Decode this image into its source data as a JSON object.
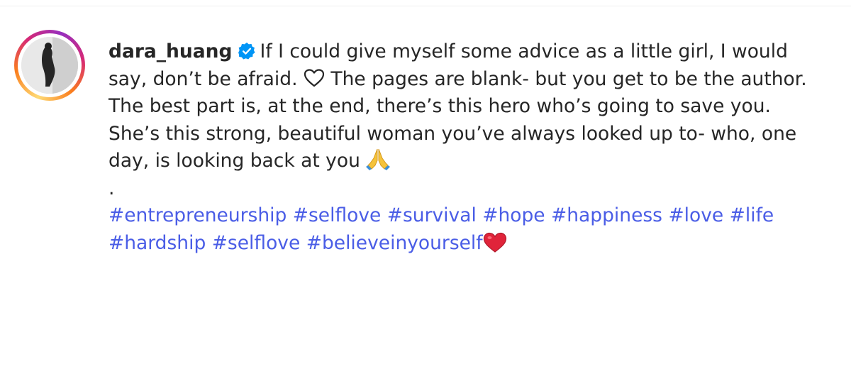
{
  "post": {
    "username": "dara_huang",
    "verified": true,
    "caption_text": "If I could give myself some advice as a little girl, I would say, don’t be afraid.",
    "caption_text_2": "The pages are blank- but you get to be the author. The best part is, at the end, there’s this hero who’s going to save you. She’s this strong, beautiful woman you’ve always looked up to- who, one day, is looking back at you",
    "separator": ".",
    "hashtags": [
      "#entrepreneurship",
      "#selflove",
      "#survival",
      "#hope",
      "#happiness",
      "#love",
      "#life",
      "#hardship",
      "#selflove",
      "#believeinyourself"
    ],
    "emojis": [
      "white-heart-icon",
      "folded-hands-icon",
      "red-heart-icon"
    ]
  },
  "colors": {
    "hashtag": "#4a5de6",
    "verified_badge": "#0095f6",
    "text": "#262626"
  }
}
